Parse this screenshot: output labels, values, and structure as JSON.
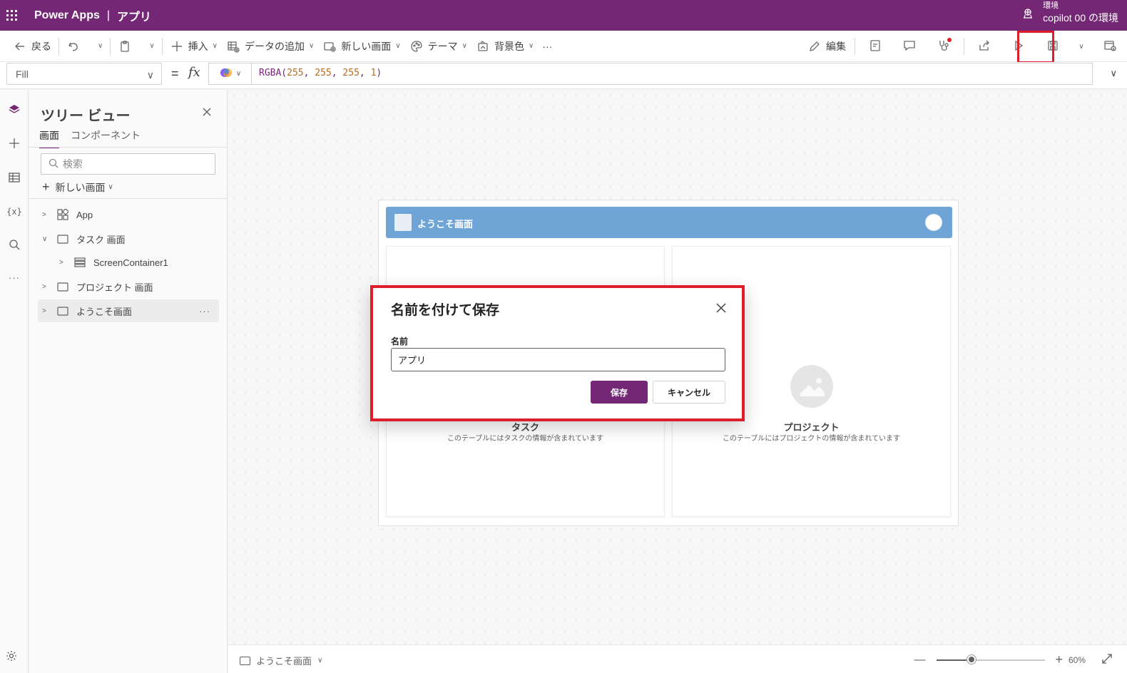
{
  "header": {
    "brand": "Power Apps",
    "separator": "|",
    "app_name": "アプリ",
    "environment_label": "環境",
    "environment_name": "copilot 00 の環境"
  },
  "toolbar": {
    "back": "戻る",
    "insert": "挿入",
    "add_data": "データの追加",
    "new_screen": "新しい画面",
    "theme": "テーマ",
    "background": "背景色",
    "more": "···",
    "edit": "編集"
  },
  "formula": {
    "property": "Fill",
    "equals": "=",
    "fx": "fx",
    "func": "RGBA(",
    "args": [
      "255",
      "255",
      "255",
      "1"
    ],
    "close": ")"
  },
  "tree": {
    "title": "ツリー ビュー",
    "tabs": [
      "画面",
      "コンポーネント"
    ],
    "search_placeholder": "検索",
    "new_screen": "新しい画面",
    "nodes": [
      {
        "label": "App"
      },
      {
        "label": "タスク 画面"
      },
      {
        "label": "ScreenContainer1"
      },
      {
        "label": "プロジェクト 画面"
      },
      {
        "label": "ようこそ画面"
      }
    ],
    "more": "···"
  },
  "canvas": {
    "header_title": "ようこそ画面",
    "cards": [
      {
        "title": "タスク",
        "desc": "このテーブルにはタスクの情報が含まれています"
      },
      {
        "title": "プロジェクト",
        "desc": "このテーブルにはプロジェクトの情報が含まれています"
      }
    ]
  },
  "bottom": {
    "screen_name": "ようこそ画面",
    "zoom": "60%",
    "zoom_value": 0.32
  },
  "dialog": {
    "title": "名前を付けて保存",
    "field_label": "名前",
    "field_value": "アプリ",
    "save": "保存",
    "cancel": "キャンセル"
  },
  "colors": {
    "brand": "#742774",
    "highlight": "#e01e2b",
    "screen_header": "#6fa5d6"
  }
}
